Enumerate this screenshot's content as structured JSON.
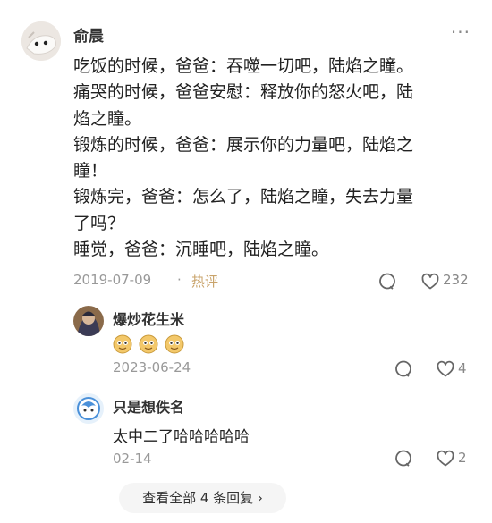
{
  "comment": {
    "author": "俞晨",
    "more_label": "···",
    "lines": [
      "吃饭的时候，爸爸：吞噬一切吧，陆焰之瞳。",
      "痛哭的时候，爸爸安慰：释放你的怒火吧，陆",
      "焰之瞳。",
      "锻炼的时候，爸爸：展示你的力量吧，陆焰之",
      "瞳！",
      "锻炼完，爸爸：怎么了，陆焰之瞳，失去力量",
      "了吗？",
      "睡觉，爸爸：沉睡吧，陆焰之瞳。"
    ],
    "date": "2019-07-09",
    "separator": "·",
    "hot_label": "热评",
    "like_count": "232"
  },
  "replies": [
    {
      "name": "爆炒花生米",
      "content_emoji": [
        "smiling-face-emoji",
        "smiling-face-emoji",
        "smiling-face-emoji"
      ],
      "date": "2023-06-24",
      "like_count": "4"
    },
    {
      "name": "只是想佚名",
      "content": "太中二了哈哈哈哈哈",
      "date": "02-14",
      "like_count": "2"
    }
  ],
  "view_all_label": "查看全部 4 条回复 ›"
}
